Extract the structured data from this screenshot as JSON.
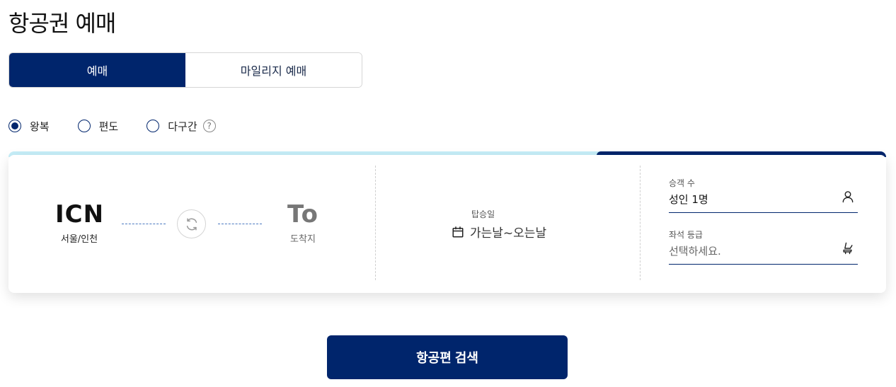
{
  "page": {
    "title": "항공권 예매"
  },
  "tabs": [
    {
      "label": "예매",
      "active": true
    },
    {
      "label": "마일리지 예매",
      "active": false
    }
  ],
  "trip_types": [
    {
      "label": "왕복",
      "checked": true
    },
    {
      "label": "편도",
      "checked": false
    },
    {
      "label": "다구간",
      "checked": false
    }
  ],
  "help_icon": {
    "icon": "question-circle-icon",
    "glyph": "?"
  },
  "step_progress": {
    "completed_fraction": 0.33
  },
  "route": {
    "from": {
      "code": "ICN",
      "city": "서울/인천"
    },
    "to": {
      "code": "To",
      "city": "도착지"
    },
    "swap_icon": "swap-arrows-icon"
  },
  "dates": {
    "label": "탑승일",
    "value": "가는날~오는날",
    "icon": "calendar-icon"
  },
  "passengers": {
    "label": "승객 수",
    "value": "성인 1명",
    "icon": "person-icon"
  },
  "cabin": {
    "label": "좌석 등급",
    "placeholder": "선택하세요.",
    "icon": "seat-icon"
  },
  "search_button": {
    "label": "항공편 검색"
  },
  "colors": {
    "primary": "#00256c",
    "progress_track": "#c6eef8",
    "route_dash": "#4a78c0"
  }
}
